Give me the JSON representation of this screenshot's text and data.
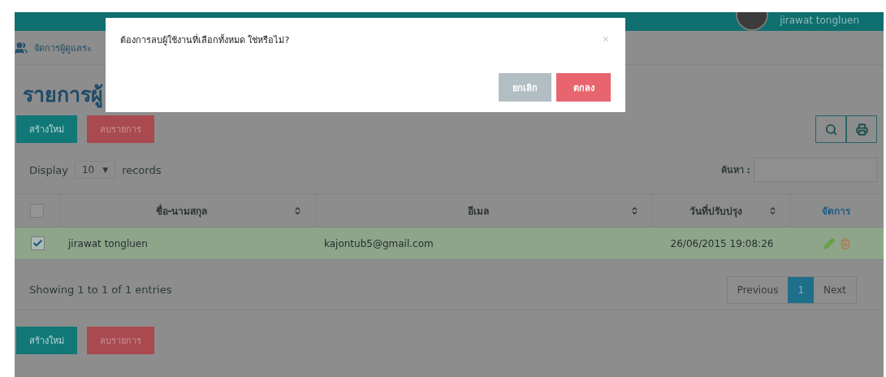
{
  "header": {
    "user_name": "jirawat tongluen"
  },
  "breadcrumb": "จัดการผู้ดูแลระ",
  "page_title": "รายการผู้",
  "top_buttons": [
    {
      "label": "สร้างใหม่",
      "kind": "create"
    },
    {
      "label": "ลบรายการ",
      "kind": "delete"
    }
  ],
  "display": {
    "prefix": "Display",
    "value": "10",
    "caret": "▼",
    "suffix": "records"
  },
  "search": {
    "label": "ค้นหา :"
  },
  "table": {
    "select_all_checked": false,
    "columns": [
      {
        "label": "ชื่อ-นามสกุล",
        "kind": "sort"
      },
      {
        "label": "อีเมล",
        "kind": "sort"
      },
      {
        "label": "วันที่ปรับปรุง",
        "kind": "sort"
      },
      {
        "label": "จัดการ",
        "kind": "action"
      }
    ],
    "rows": [
      {
        "checked": true,
        "selected": true,
        "name": "jirawat tongluen",
        "email": "kajontub5@gmail.com",
        "updated": "26/06/2015 19:08:26"
      }
    ]
  },
  "info": "Showing 1 to 1 of 1 entries",
  "pagination": [
    {
      "label": "Previous",
      "selected": false
    },
    {
      "label": "1",
      "selected": true
    },
    {
      "label": "Next",
      "selected": false
    }
  ],
  "bottom_buttons": [
    {
      "label": "สร้างใหม่",
      "kind": "create"
    },
    {
      "label": "ลบรายการ",
      "kind": "delete"
    }
  ],
  "dialog": {
    "message": "ต้องการลบผู้ใช้งานที่เลือกทั้งหมด ใช่หรือไม่?",
    "close": "×",
    "buttons": [
      {
        "label": "ยกเลิก",
        "kind": "cancel"
      },
      {
        "label": "ตกลง",
        "kind": "confirm"
      }
    ]
  }
}
